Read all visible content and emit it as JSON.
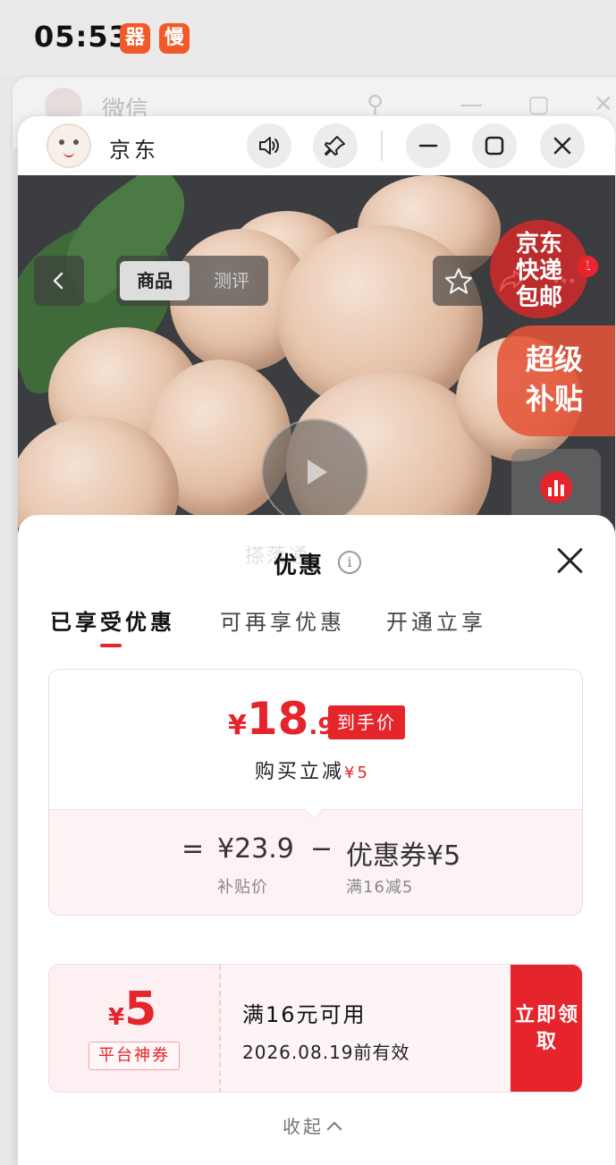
{
  "status_bar": {
    "time": "05:53",
    "app_badge_1": "器",
    "app_badge_2": "慢"
  },
  "background_window": {
    "title": "微信"
  },
  "window": {
    "title": "京东"
  },
  "product": {
    "tabs": [
      "商品",
      "测评"
    ],
    "badge_count": "1",
    "jd_free_shipping": [
      "京东",
      "快递",
      "包邮"
    ],
    "subsidy_label": [
      "超级",
      "补贴"
    ]
  },
  "sheet": {
    "watermark": "搽落通",
    "title": "优惠",
    "tabs": [
      "已享受优惠",
      "可再享优惠",
      "开通立享"
    ],
    "price": {
      "currency": "¥",
      "integer": "18",
      "decimal": ".9",
      "tag": "到手价",
      "subtitle": "购买立减",
      "subtitle_amount": "¥5"
    },
    "breakdown": {
      "equals": "=",
      "subsidy_price": "¥23.9",
      "subsidy_label": "补贴价",
      "minus": "−",
      "coupon_value": "优惠券¥5",
      "coupon_label": "满16减5"
    },
    "coupon": {
      "currency": "¥",
      "amount": "5",
      "kind": "平台神券",
      "condition": "满16元可用",
      "expiry": "2026.08.19前有效",
      "button": "立即领取"
    },
    "collapse_label": "收起"
  },
  "colors": {
    "accent_red": "#e5242b",
    "sheet_tint": "#fdf3f4"
  }
}
